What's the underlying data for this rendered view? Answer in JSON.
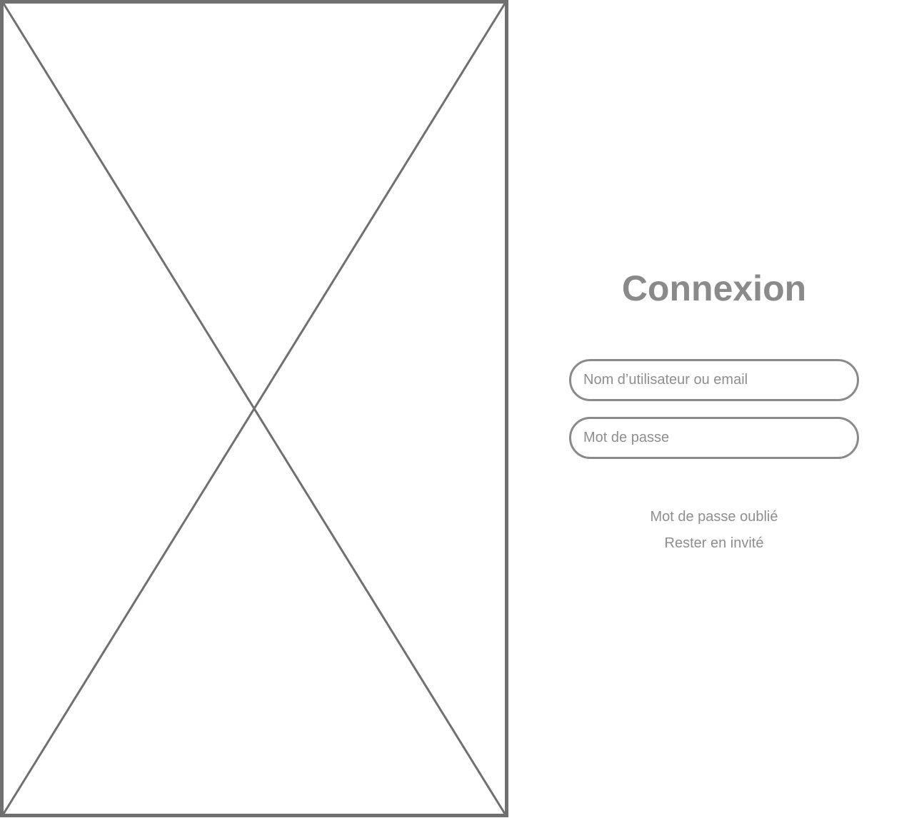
{
  "login": {
    "title": "Connexion",
    "username_placeholder": "Nom d’utilisateur ou email",
    "username_value": "",
    "password_placeholder": "Mot de passe",
    "password_value": "",
    "forgot_password_label": "Mot de passe oublié",
    "guest_label": "Rester en invité"
  },
  "colors": {
    "wireframe_stroke": "#707070",
    "text_gray": "#8a8a8a",
    "background": "#ffffff"
  },
  "icons": {
    "image_placeholder": "image-placeholder-icon"
  }
}
